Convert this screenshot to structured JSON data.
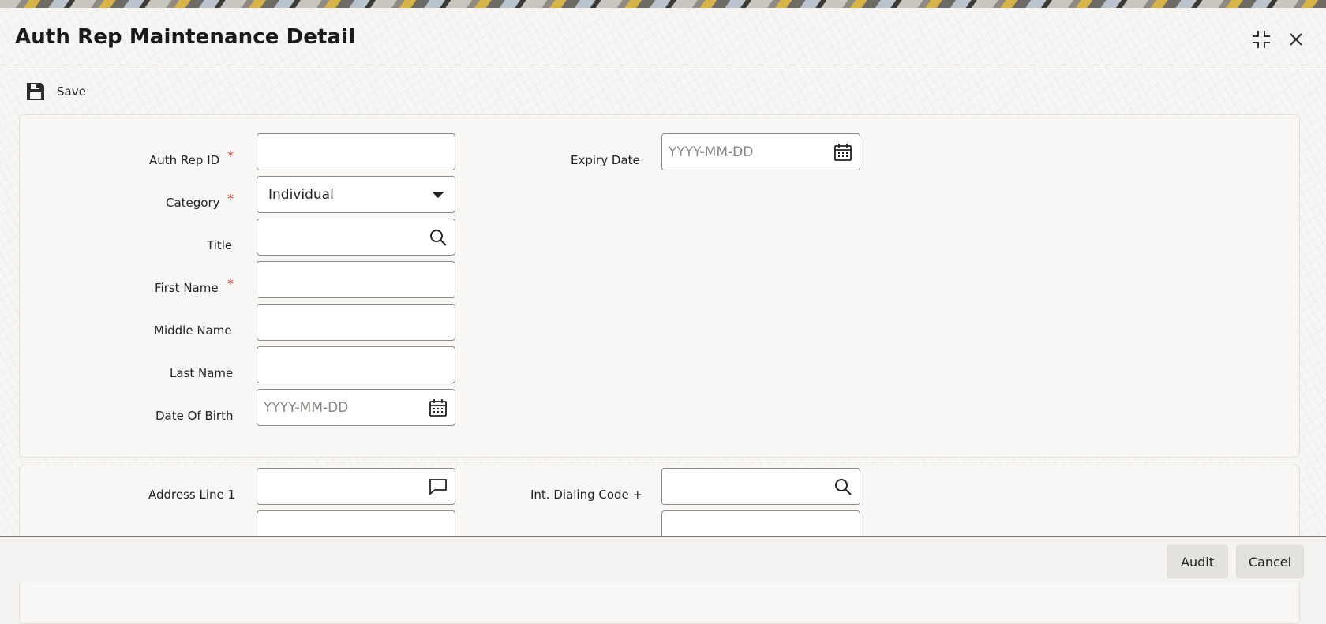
{
  "window": {
    "title": "Auth Rep Maintenance Detail"
  },
  "header_icons": {
    "maximize": "maximize-icon",
    "close": "close-icon"
  },
  "toolbar": {
    "save_label": "Save",
    "save_icon": "floppy-disk-icon"
  },
  "form": {
    "auth_rep_id": {
      "label": "Auth Rep ID",
      "required": "*",
      "value": ""
    },
    "category": {
      "label": "Category",
      "required": "*",
      "value": "Individual"
    },
    "title": {
      "label": "Title",
      "value": ""
    },
    "first_name": {
      "label": "First Name",
      "required": "*",
      "value": ""
    },
    "middle_name": {
      "label": "Middle Name",
      "value": ""
    },
    "last_name": {
      "label": "Last Name",
      "value": ""
    },
    "date_of_birth": {
      "label": "Date Of Birth",
      "placeholder": "YYYY-MM-DD"
    },
    "expiry_date": {
      "label": "Expiry Date",
      "placeholder": "YYYY-MM-DD"
    }
  },
  "address": {
    "address_line_1": {
      "label": "Address Line 1",
      "value": ""
    },
    "int_dialing_code": {
      "label": "Int. Dialing Code +",
      "value": ""
    }
  },
  "footer": {
    "audit_label": "Audit",
    "cancel_label": "Cancel"
  },
  "colors": {
    "required": "#c0392b",
    "background": "#f7f6f4",
    "border": "#8d8a85"
  }
}
